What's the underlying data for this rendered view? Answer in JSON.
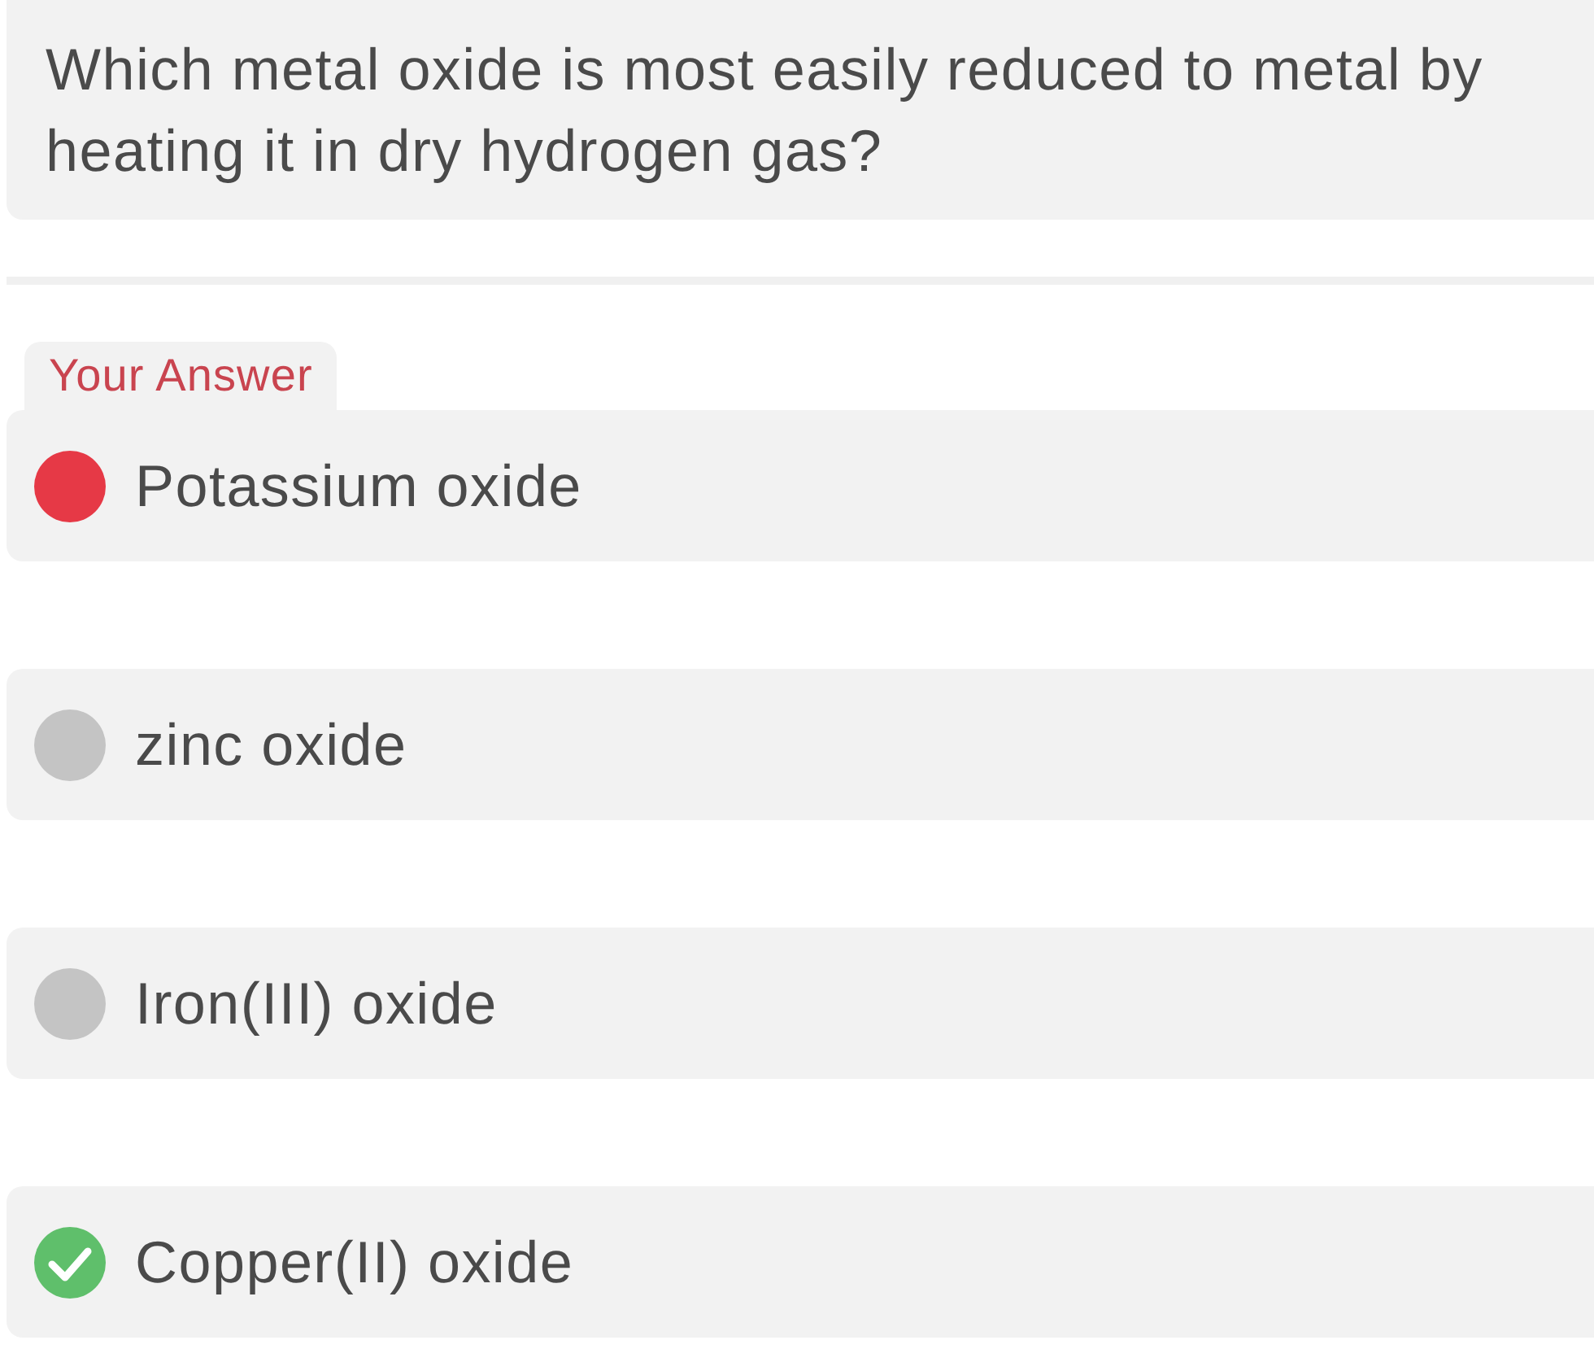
{
  "question": {
    "text": "Which metal oxide is most easily reduced to metal by heating it in dry hydrogen gas?"
  },
  "answer_tag": "Your Answer",
  "options": [
    {
      "label": "Potassium oxide",
      "selected": true,
      "correct": false
    },
    {
      "label": "zinc oxide",
      "selected": false,
      "correct": false
    },
    {
      "label": "Iron(III) oxide",
      "selected": false,
      "correct": false
    },
    {
      "label": "Copper(II) oxide",
      "selected": false,
      "correct": true
    }
  ]
}
